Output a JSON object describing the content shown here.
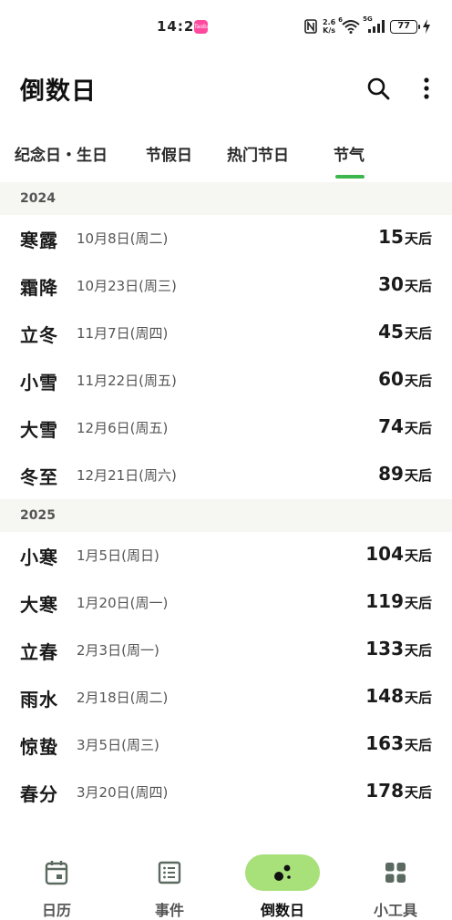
{
  "status_bar": {
    "time": "14:28",
    "app_icon_text": "Taoba",
    "net_speed_value": "2.6",
    "net_speed_unit": "K/s",
    "wifi_badge": "6",
    "cell_badge": "5G",
    "battery": "77"
  },
  "header": {
    "title": "倒数日"
  },
  "tabs": [
    {
      "label": "纪念日・生日",
      "active": false
    },
    {
      "label": "节假日",
      "active": false
    },
    {
      "label": "热门节日",
      "active": false
    },
    {
      "label": "节气",
      "active": true
    }
  ],
  "sections": [
    {
      "year": "2024",
      "rows": [
        {
          "name": "寒露",
          "date": "10月8日(周二)",
          "count": "15",
          "suffix": "天后"
        },
        {
          "name": "霜降",
          "date": "10月23日(周三)",
          "count": "30",
          "suffix": "天后"
        },
        {
          "name": "立冬",
          "date": "11月7日(周四)",
          "count": "45",
          "suffix": "天后"
        },
        {
          "name": "小雪",
          "date": "11月22日(周五)",
          "count": "60",
          "suffix": "天后"
        },
        {
          "name": "大雪",
          "date": "12月6日(周五)",
          "count": "74",
          "suffix": "天后"
        },
        {
          "name": "冬至",
          "date": "12月21日(周六)",
          "count": "89",
          "suffix": "天后"
        }
      ]
    },
    {
      "year": "2025",
      "rows": [
        {
          "name": "小寒",
          "date": "1月5日(周日)",
          "count": "104",
          "suffix": "天后"
        },
        {
          "name": "大寒",
          "date": "1月20日(周一)",
          "count": "119",
          "suffix": "天后"
        },
        {
          "name": "立春",
          "date": "2月3日(周一)",
          "count": "133",
          "suffix": "天后"
        },
        {
          "name": "雨水",
          "date": "2月18日(周二)",
          "count": "148",
          "suffix": "天后"
        },
        {
          "name": "惊蛰",
          "date": "3月5日(周三)",
          "count": "163",
          "suffix": "天后"
        },
        {
          "name": "春分",
          "date": "3月20日(周四)",
          "count": "178",
          "suffix": "天后"
        }
      ]
    }
  ],
  "bottom_nav": [
    {
      "label": "日历",
      "icon": "calendar-icon",
      "active": false
    },
    {
      "label": "事件",
      "icon": "list-icon",
      "active": false
    },
    {
      "label": "倒数日",
      "icon": "countdown-icon",
      "active": true
    },
    {
      "label": "小工具",
      "icon": "widgets-icon",
      "active": false
    }
  ],
  "colors": {
    "accent": "#3db64e",
    "active_nav_bg": "#a8e07a",
    "section_bg": "#f6f6f2"
  }
}
